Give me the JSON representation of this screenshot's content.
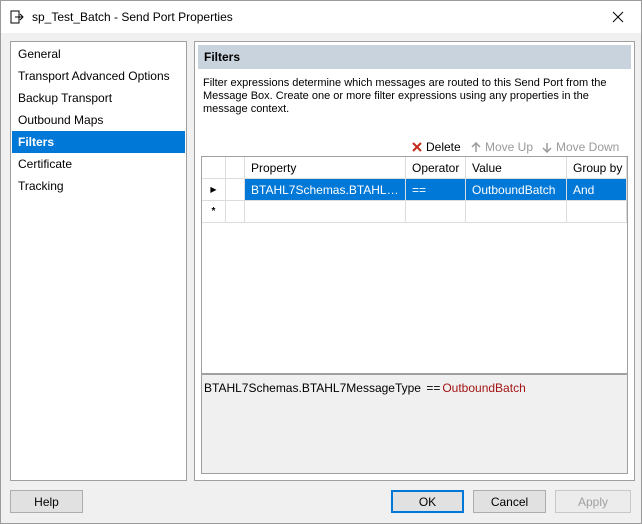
{
  "window": {
    "title": "sp_Test_Batch - Send Port Properties"
  },
  "nav": {
    "items": [
      {
        "label": "General",
        "active": false
      },
      {
        "label": "Transport Advanced Options",
        "active": false
      },
      {
        "label": "Backup Transport",
        "active": false
      },
      {
        "label": "Outbound Maps",
        "active": false
      },
      {
        "label": "Filters",
        "active": true
      },
      {
        "label": "Certificate",
        "active": false
      },
      {
        "label": "Tracking",
        "active": false
      }
    ]
  },
  "filters": {
    "header": "Filters",
    "description": "Filter expressions determine which messages are routed to this Send Port from the Message Box. Create one or more filter expressions using any properties in the message context.",
    "toolbar": {
      "delete_label": "Delete",
      "move_up_label": "Move Up",
      "move_down_label": "Move Down"
    },
    "grid": {
      "columns": [
        "Property",
        "Operator",
        "Value",
        "Group by"
      ],
      "rows": [
        {
          "marker": "▶",
          "property": "BTAHL7Schemas.BTAHL7M...",
          "operator": "==",
          "value": "OutboundBatch",
          "group_by": "And"
        }
      ],
      "new_row_marker": "*"
    },
    "expression": {
      "property": "BTAHL7Schemas.BTAHL7MessageType",
      "operator": "==",
      "value": "OutboundBatch"
    }
  },
  "buttons": {
    "help": "Help",
    "ok": "OK",
    "cancel": "Cancel",
    "apply": "Apply"
  },
  "colors": {
    "selection": "#0078d7",
    "section_header": "#c9d3de",
    "expression_value": "#a31515"
  }
}
